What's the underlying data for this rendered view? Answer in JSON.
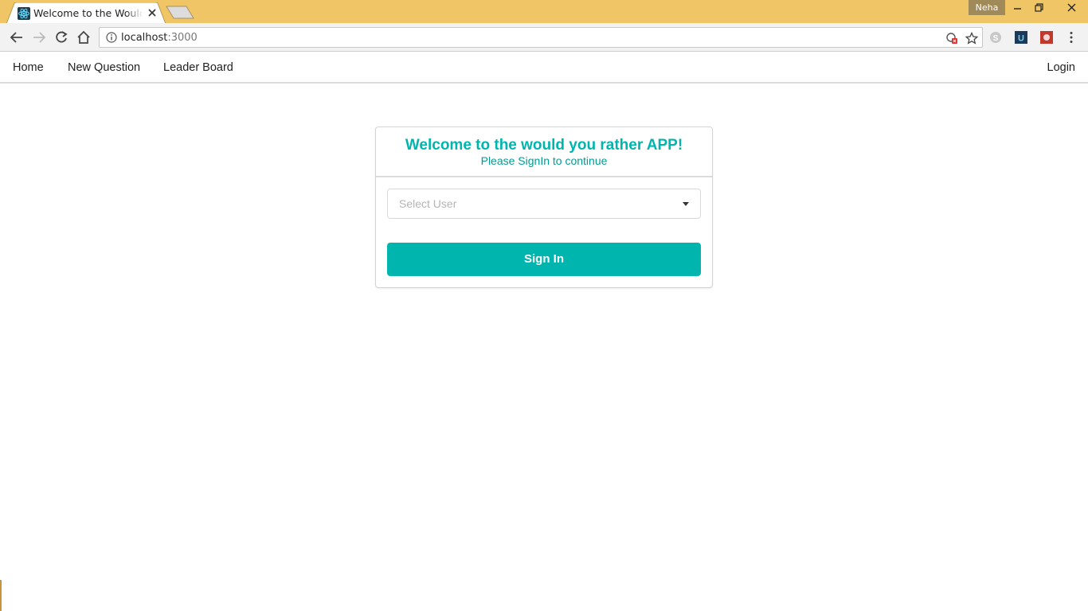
{
  "browser": {
    "tab_title": "Welcome to the Would You Rather App",
    "profile_name": "Neha",
    "url_host": "localhost",
    "url_port": ":3000"
  },
  "appnav": {
    "home": "Home",
    "new_question": "New Question",
    "leader_board": "Leader Board",
    "login": "Login"
  },
  "login_card": {
    "title": "Welcome to the would you rather APP!",
    "subtitle": "Please SignIn to continue",
    "select_placeholder": "Select User",
    "signin_label": "Sign In"
  },
  "colors": {
    "accent": "#00b5ad",
    "subtitle": "#009c95",
    "tabstrip": "#f0c566"
  },
  "icons": {
    "tab_favicon": "react-icon",
    "back": "back-arrow-icon",
    "forward": "forward-arrow-icon",
    "reload": "reload-icon",
    "home": "home-icon",
    "site_info": "info-icon",
    "blocked": "blocked-content-icon",
    "bookmark": "star-icon",
    "menu": "kebab-menu-icon"
  }
}
